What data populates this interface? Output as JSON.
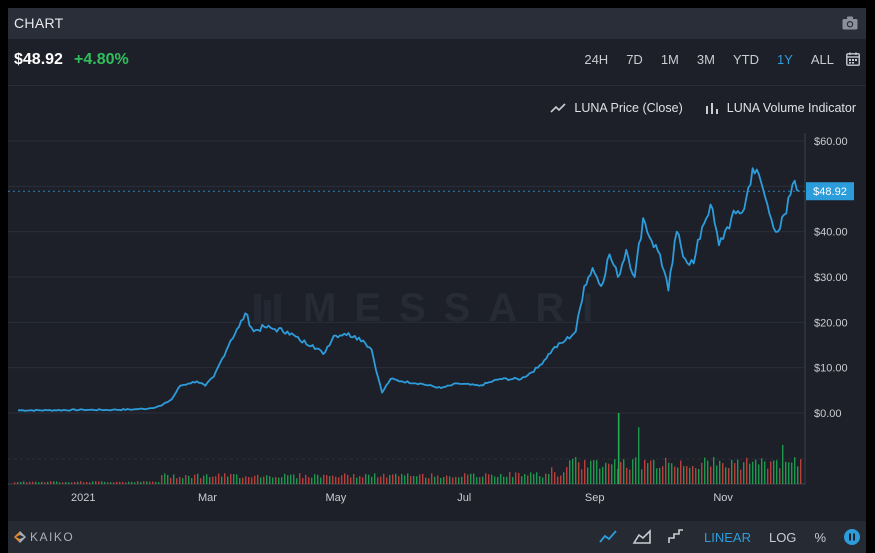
{
  "panel": {
    "title": "CHART"
  },
  "price": {
    "value": "$48.92",
    "change": "+4.80%"
  },
  "ranges": [
    {
      "label": "24H",
      "active": false
    },
    {
      "label": "7D",
      "active": false
    },
    {
      "label": "1M",
      "active": false
    },
    {
      "label": "3M",
      "active": false
    },
    {
      "label": "YTD",
      "active": false
    },
    {
      "label": "1Y",
      "active": true
    },
    {
      "label": "ALL",
      "active": false
    }
  ],
  "legend": {
    "price_label": "LUNA Price (Close)",
    "volume_label": "LUNA Volume Indicator"
  },
  "watermark": "MESSARI",
  "footer": {
    "brand": "KAIKO",
    "linear": "LINEAR",
    "log": "LOG",
    "percent": "%"
  },
  "colors": {
    "line": "#2d9cdb",
    "up": "#1fae52",
    "down": "#d6453d",
    "accent": "#2d9cdb",
    "positive": "#2fbf5d"
  },
  "chart_data": {
    "type": "line",
    "x_tick_labels": [
      "2021",
      "Mar",
      "May",
      "Jul",
      "Sep",
      "Nov"
    ],
    "y_tick_labels": [
      "$60.00",
      "$50.00",
      "$40.00",
      "$30.00",
      "$20.00",
      "$10.00",
      "$0.00"
    ],
    "ylim": [
      0,
      60
    ],
    "current_label": "$48.92",
    "current_value": 48.92,
    "grid": true,
    "legend_position": "top-right",
    "series": [
      {
        "name": "LUNA Price (Close)",
        "points": [
          [
            "2020-12-01",
            0.6
          ],
          [
            "2020-12-15",
            0.6
          ],
          [
            "2021-01-01",
            0.7
          ],
          [
            "2021-01-15",
            0.7
          ],
          [
            "2021-01-25",
            0.8
          ],
          [
            "2021-02-01",
            1.0
          ],
          [
            "2021-02-07",
            1.6
          ],
          [
            "2021-02-12",
            3.0
          ],
          [
            "2021-02-16",
            6.0
          ],
          [
            "2021-02-20",
            6.5
          ],
          [
            "2021-02-24",
            7.0
          ],
          [
            "2021-02-28",
            6.0
          ],
          [
            "2021-03-04",
            8.0
          ],
          [
            "2021-03-08",
            12.0
          ],
          [
            "2021-03-12",
            16.0
          ],
          [
            "2021-03-16",
            19.0
          ],
          [
            "2021-03-19",
            22.0
          ],
          [
            "2021-03-23",
            18.0
          ],
          [
            "2021-03-28",
            19.0
          ],
          [
            "2021-04-02",
            18.5
          ],
          [
            "2021-04-08",
            18.0
          ],
          [
            "2021-04-14",
            16.0
          ],
          [
            "2021-04-20",
            15.0
          ],
          [
            "2021-04-25",
            13.0
          ],
          [
            "2021-04-30",
            17.0
          ],
          [
            "2021-05-05",
            17.5
          ],
          [
            "2021-05-10",
            17.0
          ],
          [
            "2021-05-14",
            16.0
          ],
          [
            "2021-05-18",
            14.0
          ],
          [
            "2021-05-21",
            8.0
          ],
          [
            "2021-05-23",
            4.5
          ],
          [
            "2021-05-27",
            7.5
          ],
          [
            "2021-06-01",
            7.0
          ],
          [
            "2021-06-10",
            6.5
          ],
          [
            "2021-06-20",
            5.5
          ],
          [
            "2021-06-28",
            6.5
          ],
          [
            "2021-07-08",
            6.0
          ],
          [
            "2021-07-18",
            7.5
          ],
          [
            "2021-07-28",
            7.5
          ],
          [
            "2021-08-05",
            10.0
          ],
          [
            "2021-08-12",
            14.0
          ],
          [
            "2021-08-18",
            16.0
          ],
          [
            "2021-08-23",
            18.0
          ],
          [
            "2021-08-27",
            28.0
          ],
          [
            "2021-08-31",
            32.0
          ],
          [
            "2021-09-04",
            28.0
          ],
          [
            "2021-09-08",
            35.0
          ],
          [
            "2021-09-12",
            30.0
          ],
          [
            "2021-09-16",
            36.0
          ],
          [
            "2021-09-20",
            30.0
          ],
          [
            "2021-09-24",
            43.0
          ],
          [
            "2021-09-28",
            38.0
          ],
          [
            "2021-10-02",
            35.0
          ],
          [
            "2021-10-06",
            27.0
          ],
          [
            "2021-10-10",
            40.0
          ],
          [
            "2021-10-14",
            34.0
          ],
          [
            "2021-10-18",
            33.0
          ],
          [
            "2021-10-22",
            41.0
          ],
          [
            "2021-10-26",
            46.0
          ],
          [
            "2021-10-30",
            37.0
          ],
          [
            "2021-11-03",
            41.0
          ],
          [
            "2021-11-07",
            44.0
          ],
          [
            "2021-11-11",
            45.0
          ],
          [
            "2021-11-15",
            54.0
          ],
          [
            "2021-11-19",
            51.0
          ],
          [
            "2021-11-23",
            44.0
          ],
          [
            "2021-11-27",
            40.0
          ],
          [
            "2021-12-01",
            44.0
          ],
          [
            "2021-12-04",
            50.5
          ],
          [
            "2021-12-07",
            48.9
          ]
        ]
      }
    ],
    "volume_series_name": "LUNA Volume Indicator",
    "volume_note": "relative volume bars, red/green"
  }
}
